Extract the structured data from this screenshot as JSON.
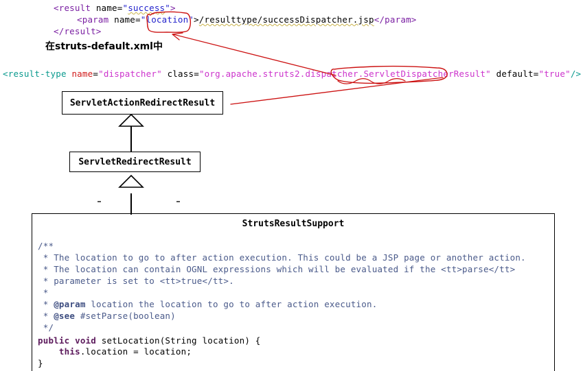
{
  "xml_top": {
    "line_result": {
      "open_lt": "<",
      "tag": "result",
      "space": " ",
      "attr": "name",
      "eq": "=",
      "quote_open": "\"",
      "value": "success",
      "quote_close": "\"",
      "close_gt": ">"
    },
    "line_param": {
      "open_lt": "<",
      "tag": "param",
      "space": " ",
      "attr": "name",
      "eq": "=",
      "quote_open": "\"",
      "value": "location",
      "quote_close": "\"",
      "close_gt": ">",
      "text": "/resulttype/successDispatcher.jsp",
      "close_tag": "</param>"
    },
    "line_result_end": {
      "close_tag": "</result>"
    }
  },
  "cn_note": {
    "text": "在struts-default.xml中"
  },
  "xml_resulttype": {
    "open_lt": "<",
    "tag": "result-type",
    "space1": " ",
    "attr_name": "name",
    "eq1": "=",
    "q1": "\"",
    "val_name": "dispatcher",
    "q2": "\"",
    "space2": " ",
    "attr_class": "class",
    "eq2": "=",
    "q3": "\"",
    "val_class_prefix": "org.apache.struts2.dispatcher.",
    "val_class_circled": "ServletDispatcherResult",
    "q4": "\"",
    "space3": " ",
    "attr_default": "default",
    "eq3": "=",
    "q5": "\"",
    "val_default": "true",
    "q6": "\"",
    "selfclose": "/>"
  },
  "uml": {
    "class_top": "ServletActionRedirectResult",
    "class_mid": "ServletRedirectResult",
    "class_bottom": "StrutsResultSupport"
  },
  "java_code": {
    "l1": "/**",
    "l2_star": " * ",
    "l2_text": "The location to go to after action execution. This could be a JSP page or another action.",
    "l3_star": " * ",
    "l3_text": "The location can contain OGNL expressions which will be evaluated if the <tt>parse</tt>",
    "l4_star": " * ",
    "l4_text": "parameter is set to <tt>true</tt>.",
    "l5": " *",
    "l6_star": " * ",
    "l6_tag": "@param",
    "l6_text": " location the location to go to after action execution.",
    "l7_star": " * ",
    "l7_tag": "@see",
    "l7_text": " #setParse(boolean)",
    "l8": " */",
    "l9_kw1": "public",
    "l9_sp1": " ",
    "l9_kw2": "void",
    "l9_rest": " setLocation(String location) {",
    "l10_indent": "    ",
    "l10_kw": "this",
    "l10_rest": ".location = location;",
    "l11": "}"
  },
  "colors": {
    "annotation_red": "#cc1111",
    "xml_tag_purple": "#7a1fa2",
    "xml_tag_teal": "#0a9a8e",
    "xml_attr_red": "#d01a1a",
    "xml_value_blue": "#2222cc",
    "xml_value_magenta": "#cc33cc",
    "javadoc_blue": "#4a5a8a",
    "java_keyword": "#5c1a5c",
    "uml_border": "#000000",
    "background": "#ffffff"
  }
}
